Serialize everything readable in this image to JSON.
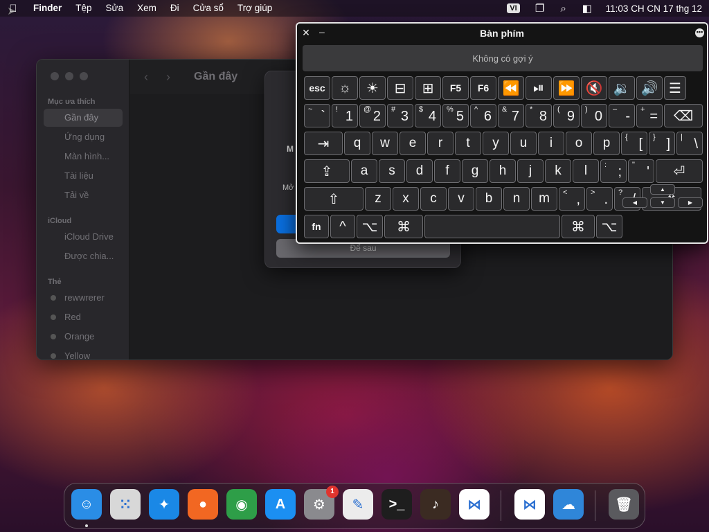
{
  "menubar": {
    "apple_icon": "apple-logo-icon",
    "app_name": "Finder",
    "menus": [
      "Tệp",
      "Sửa",
      "Xem",
      "Đi",
      "Cửa sổ",
      "Trợ giúp"
    ],
    "input_source": "VI",
    "clock": "11:03 CH CN 17 thg 12"
  },
  "finder": {
    "location": "Gần đây",
    "sections": {
      "favorites": "Mục ưa thích",
      "icloud": "iCloud",
      "tags": "Thẻ"
    },
    "favorites": [
      "Gần đây",
      "Ứng dụng",
      "Màn hình...",
      "Tài liệu",
      "Tải về"
    ],
    "icloud_items": [
      "iCloud Drive",
      "Được chia..."
    ],
    "tags": [
      "rewwrerer",
      "Red",
      "Orange",
      "Yellow"
    ]
  },
  "dialog": {
    "text1": "M",
    "text2": "Mở",
    "secondary_button": "Để sau"
  },
  "keyboard": {
    "title": "Bàn phím",
    "suggestion": "Không có gợi ý",
    "rows": [
      [
        {
          "main": "esc",
          "w": 38,
          "cls": "fn-key"
        },
        {
          "main": "☼",
          "w": 38,
          "icon": "brightness-down-icon"
        },
        {
          "main": "☀",
          "w": 38,
          "icon": "brightness-up-icon"
        },
        {
          "main": "⊟",
          "w": 38,
          "icon": "mission-control-icon"
        },
        {
          "main": "⊞",
          "w": 38,
          "icon": "launchpad-icon"
        },
        {
          "main": "F5",
          "w": 38,
          "cls": "fn-key"
        },
        {
          "main": "F6",
          "w": 38,
          "cls": "fn-key"
        },
        {
          "main": "⏪",
          "w": 38,
          "icon": "rewind-icon"
        },
        {
          "main": "⏯",
          "w": 38,
          "icon": "play-pause-icon"
        },
        {
          "main": "⏩",
          "w": 38,
          "icon": "fast-forward-icon"
        },
        {
          "main": "🔇",
          "w": 38,
          "icon": "mute-icon"
        },
        {
          "main": "🔉",
          "w": 38,
          "icon": "volume-down-icon"
        },
        {
          "main": "🔊",
          "w": 38,
          "icon": "volume-up-icon"
        },
        {
          "main": "☰",
          "w": 32,
          "icon": "list-icon"
        }
      ],
      [
        {
          "sub": "~",
          "main": "`",
          "w": 38
        },
        {
          "sub": "!",
          "main": "1",
          "w": 38
        },
        {
          "sub": "@",
          "main": "2",
          "w": 38
        },
        {
          "sub": "#",
          "main": "3",
          "w": 38
        },
        {
          "sub": "$",
          "main": "4",
          "w": 38
        },
        {
          "sub": "%",
          "main": "5",
          "w": 38
        },
        {
          "sub": "^",
          "main": "6",
          "w": 38
        },
        {
          "sub": "&",
          "main": "7",
          "w": 38
        },
        {
          "sub": "*",
          "main": "8",
          "w": 38
        },
        {
          "sub": "(",
          "main": "9",
          "w": 38
        },
        {
          "sub": ")",
          "main": "0",
          "w": 38
        },
        {
          "sub": "–",
          "main": "-",
          "w": 38
        },
        {
          "sub": "+",
          "main": "=",
          "w": 38
        },
        {
          "main": "⌫",
          "w": 56,
          "icon": "delete-icon"
        }
      ],
      [
        {
          "main": "⇥",
          "w": 56,
          "icon": "tab-icon"
        },
        {
          "main": "q",
          "w": 38
        },
        {
          "main": "w",
          "w": 38
        },
        {
          "main": "e",
          "w": 38
        },
        {
          "main": "r",
          "w": 38
        },
        {
          "main": "t",
          "w": 38
        },
        {
          "main": "y",
          "w": 38
        },
        {
          "main": "u",
          "w": 38
        },
        {
          "main": "i",
          "w": 38
        },
        {
          "main": "o",
          "w": 38
        },
        {
          "main": "p",
          "w": 38
        },
        {
          "sub": "{",
          "main": "[",
          "w": 38
        },
        {
          "sub": "}",
          "main": "]",
          "w": 38
        },
        {
          "sub": "|",
          "main": "\\",
          "w": 38
        }
      ],
      [
        {
          "main": "⇪",
          "w": 66,
          "icon": "caps-lock-icon"
        },
        {
          "main": "a",
          "w": 38
        },
        {
          "main": "s",
          "w": 38
        },
        {
          "main": "d",
          "w": 38
        },
        {
          "main": "f",
          "w": 38
        },
        {
          "main": "g",
          "w": 38
        },
        {
          "main": "h",
          "w": 38
        },
        {
          "main": "j",
          "w": 38
        },
        {
          "main": "k",
          "w": 38
        },
        {
          "main": "l",
          "w": 38
        },
        {
          "sub": ":",
          "main": ";",
          "w": 38
        },
        {
          "sub": "\"",
          "main": "'",
          "w": 38
        },
        {
          "main": "⏎",
          "w": 68,
          "icon": "return-icon"
        }
      ],
      [
        {
          "main": "⇧",
          "w": 86,
          "icon": "shift-left-icon"
        },
        {
          "main": "z",
          "w": 38
        },
        {
          "main": "x",
          "w": 38
        },
        {
          "main": "c",
          "w": 38
        },
        {
          "main": "v",
          "w": 38
        },
        {
          "main": "b",
          "w": 38
        },
        {
          "main": "n",
          "w": 38
        },
        {
          "main": "m",
          "w": 38
        },
        {
          "sub": "<",
          "main": ",",
          "w": 38
        },
        {
          "sub": ">",
          "main": ".",
          "w": 38
        },
        {
          "sub": "?",
          "main": "/",
          "w": 38
        },
        {
          "main": "⇧",
          "w": 86,
          "icon": "shift-right-icon"
        }
      ],
      [
        {
          "main": "fn",
          "w": 36,
          "cls": "fn-key"
        },
        {
          "main": "^",
          "w": 36,
          "icon": "control-icon"
        },
        {
          "main": "⌥",
          "w": 38,
          "icon": "option-icon"
        },
        {
          "main": "⌘",
          "w": 56,
          "icon": "command-icon"
        },
        {
          "main": "",
          "w": 196,
          "icon": "space-bar"
        },
        {
          "main": "⌘",
          "w": 48,
          "icon": "command-right-icon"
        },
        {
          "main": "⌥",
          "w": 38,
          "icon": "option-right-icon"
        }
      ]
    ],
    "arrows": {
      "up": "▲",
      "left": "◀",
      "down": "▼",
      "right": "▶"
    }
  },
  "dock": {
    "apps": [
      {
        "name": "finder-app",
        "glyph": "☺",
        "color": "#2a8de6"
      },
      {
        "name": "launchpad-app",
        "glyph": "⁙",
        "color": "#d8d8d8"
      },
      {
        "name": "safari-app",
        "glyph": "✦",
        "color": "#1a88e6"
      },
      {
        "name": "firefox-app",
        "glyph": "●",
        "color": "#f26722"
      },
      {
        "name": "chrome-app",
        "glyph": "◉",
        "color": "#2e9e48"
      },
      {
        "name": "app-store-app",
        "glyph": "A",
        "color": "#1b8ff2"
      },
      {
        "name": "system-settings-app",
        "glyph": "⚙",
        "color": "#8a8a8e"
      },
      {
        "name": "textedit-app",
        "glyph": "✎",
        "color": "#ececec"
      },
      {
        "name": "terminal-app",
        "glyph": ">_",
        "color": "#1e1e1e"
      },
      {
        "name": "garageband-app",
        "glyph": "♪",
        "color": "#3b2b22"
      },
      {
        "name": "vscode-app",
        "glyph": "⋈",
        "color": "#ffffff"
      },
      {
        "name": "visual-studio-app",
        "glyph": "⋈",
        "color": "#ffffff"
      },
      {
        "name": "weather-app",
        "glyph": "☁",
        "color": "#2f86d9"
      },
      {
        "name": "trash-app",
        "glyph": "🗑",
        "color": "#5a5a5e"
      }
    ],
    "settings_badge": "1"
  }
}
